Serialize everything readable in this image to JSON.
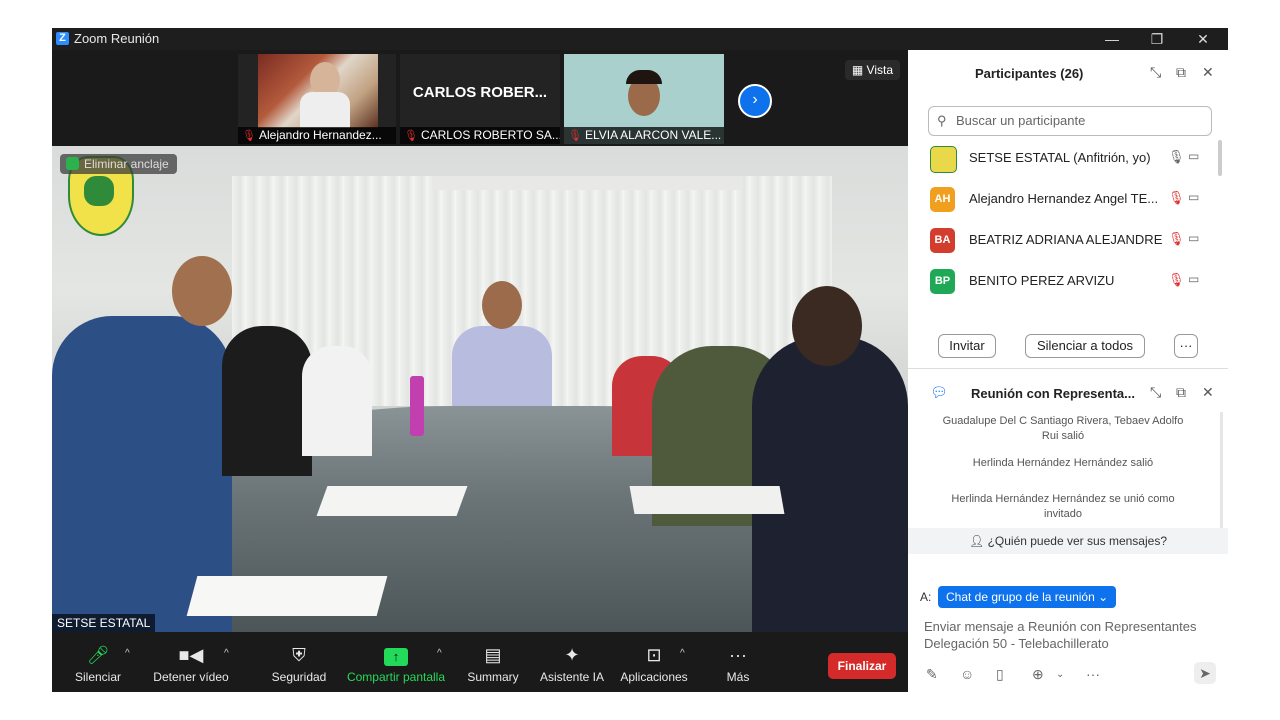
{
  "window": {
    "app_title": "Zoom Reunión",
    "minimize": "—",
    "restore": "❐",
    "close": "✕"
  },
  "thumbnails": [
    {
      "label": "Alejandro Hernandez...",
      "mic": "muted"
    },
    {
      "display_name": "CARLOS ROBER...",
      "label": "CARLOS ROBERTO SA...",
      "mic": "muted"
    },
    {
      "label": "ELVIA ALARCON VALE...",
      "mic": "muted"
    }
  ],
  "stage": {
    "vista_label": "Vista",
    "pin_badge": "Eliminar anclaje",
    "speaker_name": "SETSE ESTATAL",
    "next_arrow": "›"
  },
  "toolbar": {
    "items": [
      {
        "label": "Silenciar",
        "icon": "microphone-icon"
      },
      {
        "label": "Detener vídeo",
        "icon": "video-camera-icon"
      },
      {
        "label": "Seguridad",
        "icon": "shield-icon"
      },
      {
        "label": "Compartir pantalla",
        "icon": "share-screen-icon"
      },
      {
        "label": "Summary",
        "icon": "summary-icon"
      },
      {
        "label": "Asistente IA",
        "icon": "sparkle-icon"
      },
      {
        "label": "Aplicaciones",
        "icon": "apps-icon"
      },
      {
        "label": "Más",
        "icon": "more-icon"
      }
    ],
    "end_label": "Finalizar",
    "colors": {
      "share": "#23d959",
      "end": "#d42a2a"
    }
  },
  "participants": {
    "title": "Participantes (26)",
    "search_placeholder": "Buscar un participante",
    "list": [
      {
        "initials": "",
        "name": "SETSE ESTATAL (Anfitrión, yo)",
        "color": "#e8d84a",
        "mic": "on"
      },
      {
        "initials": "AH",
        "name": "Alejandro Hernandez Angel TE...",
        "color": "#f0a01e",
        "mic": "muted"
      },
      {
        "initials": "BA",
        "name": "BEATRIZ ADRIANA ALEJANDRE",
        "color": "#d23d2e",
        "mic": "muted"
      },
      {
        "initials": "BP",
        "name": "BENITO PEREZ ARVIZU",
        "color": "#1fa855",
        "mic": "muted"
      }
    ],
    "invite_label": "Invitar",
    "mute_all_label": "Silenciar a todos",
    "more_label": "···"
  },
  "chat": {
    "title": "Reunión con Representa...",
    "messages": [
      "Guadalupe Del C Santiago Rivera, Tebaev Adolfo Rui salió",
      "Herlinda Hernández Hernández salió",
      "Herlinda Hernández Hernández se unió como invitado"
    ],
    "who_can_see": "¿Quién puede ver sus mensajes?",
    "to_label": "A:",
    "to_value": "Chat de grupo de la reunión",
    "input_placeholder": "Enviar mensaje a Reunión con Representantes Delegación 50 - Telebachillerato"
  }
}
